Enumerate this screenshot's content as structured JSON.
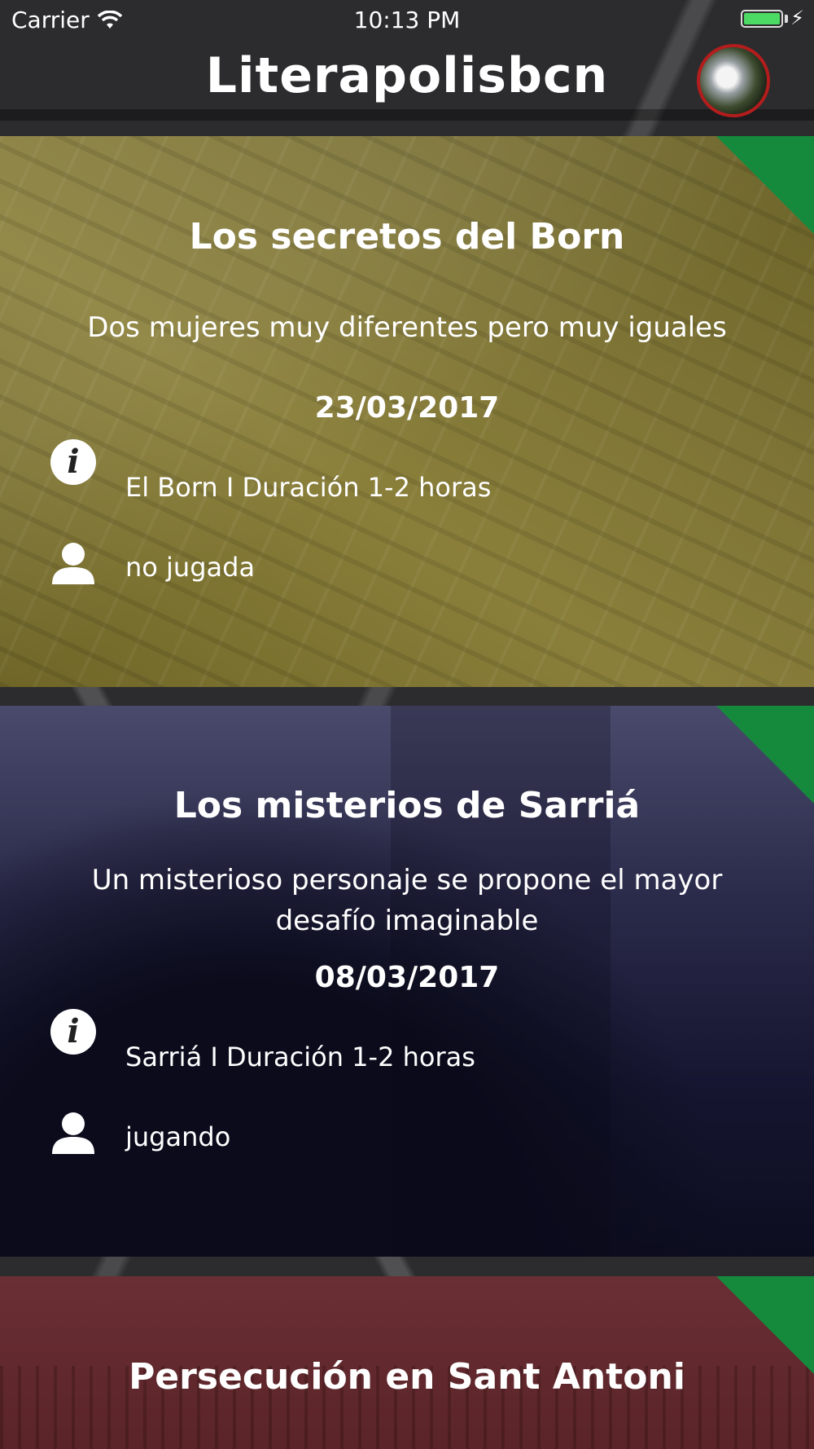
{
  "status_bar": {
    "carrier": "Carrier",
    "time": "10:13 PM",
    "battery_level": 1.0
  },
  "header": {
    "title": "Literapolisbcn"
  },
  "colors": {
    "corner_accent": "#158a3c",
    "avatar_ring": "#b31d1d",
    "battery": "#4cd964"
  },
  "cards": [
    {
      "title": "Los secretos del Born",
      "subtitle": "Dos mujeres muy diferentes pero muy iguales",
      "date": "23/03/2017",
      "info": "El Born I Duración 1-2 horas",
      "status": "no jugada"
    },
    {
      "title": "Los misterios de Sarriá",
      "subtitle": "Un misterioso personaje se propone el mayor desafío imaginable",
      "date": "08/03/2017",
      "info": "Sarriá I Duración 1-2 horas",
      "status": "jugando"
    },
    {
      "title": "Persecución en Sant Antoni"
    }
  ]
}
